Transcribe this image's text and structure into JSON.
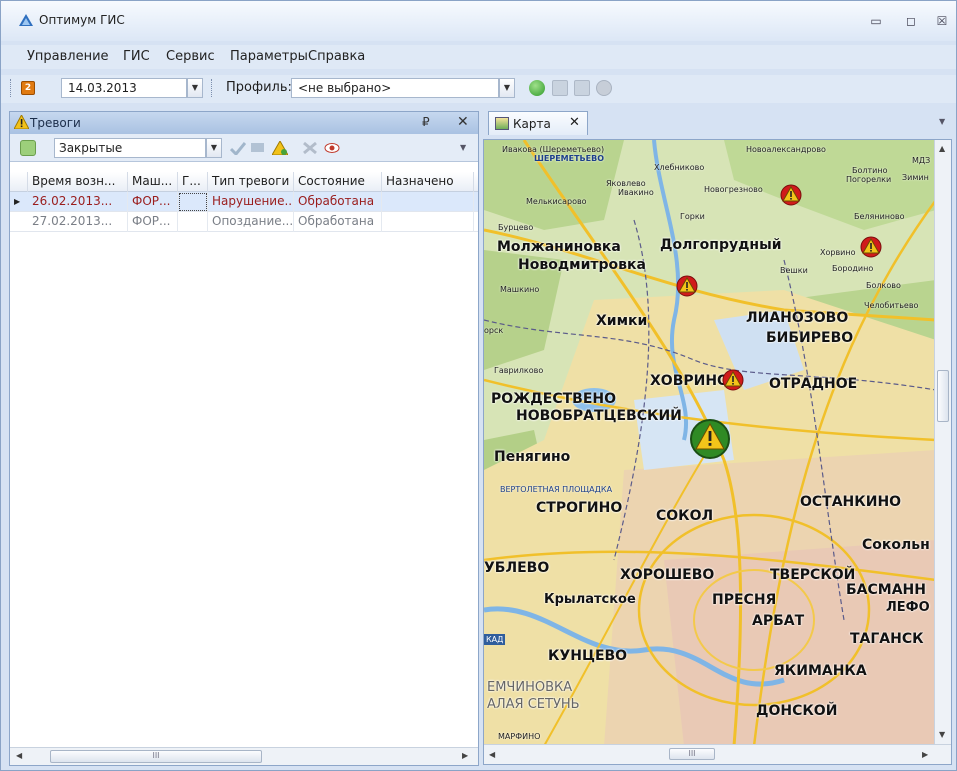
{
  "window": {
    "title": "Оптимум ГИС",
    "icon": "app-triangle-icon"
  },
  "menu": [
    "Управление",
    "ГИС",
    "Сервис",
    "Параметры",
    "Справка"
  ],
  "toolbar": {
    "date": "14.03.2013",
    "profile_label": "Профиль:",
    "profile_value": "<не выбрано>"
  },
  "alarms_panel": {
    "title": "Тревоги",
    "filter_value": "Закрытые",
    "columns": [
      "Время возн...",
      "Маш...",
      "Г...",
      "Тип тревоги",
      "Состояние",
      "Назначено"
    ],
    "rows": [
      {
        "time": "26.02.2013...",
        "vehicle": "ФОР...",
        "g": "",
        "type": "Нарушение...",
        "state": "Обработана",
        "assigned": "",
        "selected": true
      },
      {
        "time": "27.02.2013...",
        "vehicle": "ФОР...",
        "g": "",
        "type": "Опоздание...",
        "state": "Обработана",
        "assigned": "",
        "selected": false
      }
    ],
    "scroll_grip": "III"
  },
  "map_tab": {
    "label": "Карта",
    "scroll_grip": "III"
  },
  "map_labels": {
    "large": [
      "Молжаниновка",
      "Долгопрудный",
      "Новодмитровка",
      "Химки",
      "ЛИАНОЗОВО",
      "БИБИРЕВО",
      "ХОВРИНО",
      "ОТРАДНОЕ",
      "РОЖДЕСТВЕНО",
      "НОВОБРАТЦЕВСКИЙ",
      "Пенягино",
      "СТРОГИНО",
      "СОКОЛ",
      "ОСТАНКИНО",
      "Сокольн",
      "УБЛЕВО",
      "ХОРОШЕВО",
      "ТВЕРСКОЙ",
      "БАСМАНН",
      "ЛЕФО",
      "Крылатское",
      "ПРЕСНЯ",
      "АРБАТ",
      "ТАГАНСК",
      "КУНЦЕВО",
      "ЯКИМАНКА",
      "ЕМЧИНОВКА",
      "АЛАЯ СЕТУНЬ",
      "ДОНСКОЙ"
    ],
    "small": [
      "Ивакова (Шереметьево)",
      "ШЕРЕМЕТЬЕВО",
      "Хлебниково",
      "Новоалександрово",
      "Болтино",
      "Зимин",
      "МДЗ",
      "Погорелки",
      "Яковлево",
      "Ивакино",
      "Новогрезново",
      "Мелькисарово",
      "Горки",
      "Беляниново",
      "Бурцево",
      "Хорвино",
      "Вешки",
      "Бородино",
      "Болково",
      "Машкино",
      "Челобитьево",
      "орск",
      "Гаврилково",
      "ВЕРТОЛЕТНАЯ ПЛОЩАДКА",
      "КАД",
      "МАРФИНО"
    ]
  },
  "colors": {
    "accent": "#2f5d9c",
    "alarm_red": "#d01b1b",
    "alarm_yellow": "#f3c41a",
    "alarm_green": "#2f8a24"
  }
}
